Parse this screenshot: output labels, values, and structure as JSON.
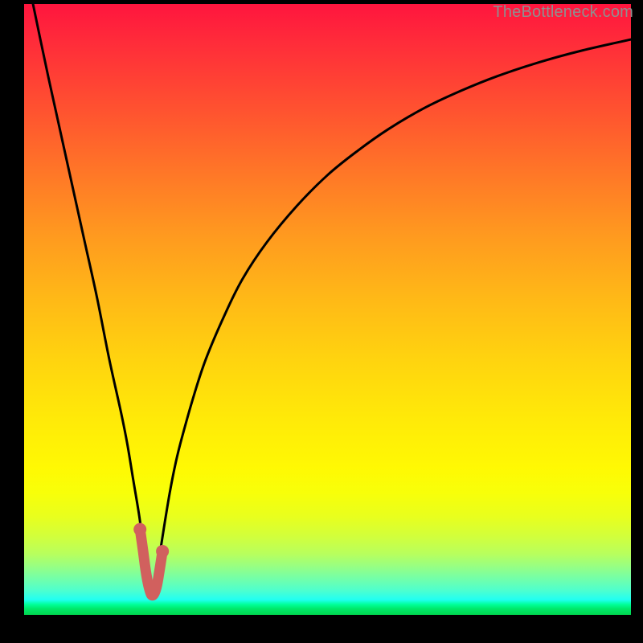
{
  "watermark": "TheBottleneck.com",
  "colors": {
    "background": "#000000",
    "curve": "#000000",
    "highlight": "#d1605e"
  },
  "chart_data": {
    "type": "line",
    "title": "",
    "xlabel": "",
    "ylabel": "",
    "xlim": [
      0,
      100
    ],
    "ylim": [
      0,
      100
    ],
    "grid": false,
    "legend": false,
    "x_optimal": 21,
    "series": [
      {
        "name": "bottleneck-curve",
        "x": [
          0,
          4,
          8,
          10,
          12,
          14,
          16,
          17,
          18,
          19,
          19.7,
          20.2,
          20.7,
          21,
          21.4,
          21.8,
          22.3,
          23,
          24,
          25,
          26,
          28,
          30,
          33,
          36,
          40,
          45,
          50,
          55,
          60,
          66,
          72,
          78,
          85,
          92,
          100
        ],
        "y": [
          107,
          88,
          70,
          61,
          52,
          42,
          33,
          28,
          22,
          16,
          10.5,
          6.8,
          3.8,
          2.7,
          3.6,
          5.8,
          9.5,
          14,
          20,
          25,
          29,
          36,
          42,
          49,
          55,
          61,
          67,
          72,
          76,
          79.5,
          83,
          85.8,
          88.2,
          90.5,
          92.4,
          94.2
        ]
      }
    ],
    "highlight_segment": {
      "x": [
        19.1,
        19.6,
        20.0,
        20.4,
        20.8,
        21.1,
        21.5,
        21.9,
        22.3,
        22.8
      ],
      "y": [
        14.0,
        10.5,
        7.5,
        5.2,
        3.7,
        3.2,
        3.6,
        4.9,
        7.2,
        10.4
      ]
    }
  }
}
